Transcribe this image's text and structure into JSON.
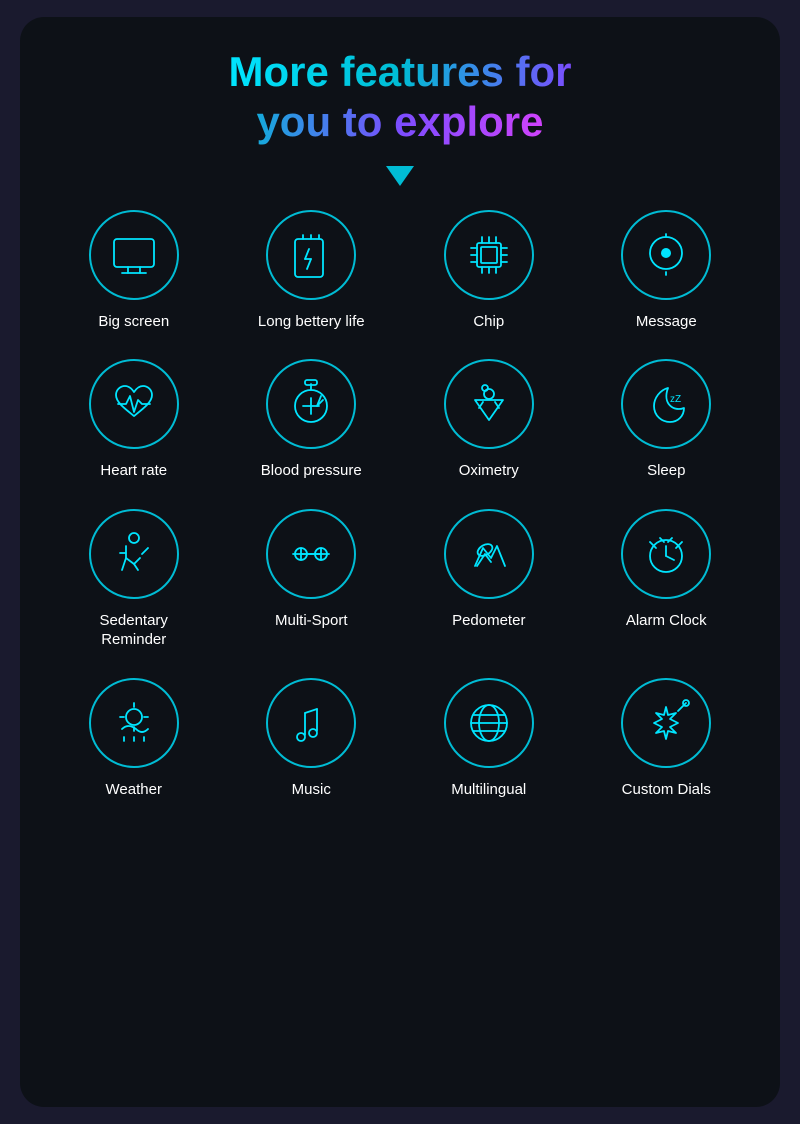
{
  "header": {
    "line1": "More features for",
    "line2": "you to explore"
  },
  "features": [
    {
      "id": "big-screen",
      "label": "Big screen",
      "icon": "big-screen"
    },
    {
      "id": "long-battery",
      "label": "Long bettery life",
      "icon": "battery"
    },
    {
      "id": "chip",
      "label": "Chip",
      "icon": "chip"
    },
    {
      "id": "message",
      "label": "Message",
      "icon": "message"
    },
    {
      "id": "heart-rate",
      "label": "Heart rate",
      "icon": "heart-rate"
    },
    {
      "id": "blood-pressure",
      "label": "Blood pressure",
      "icon": "blood-pressure"
    },
    {
      "id": "oximetry",
      "label": "Oximetry",
      "icon": "oximetry"
    },
    {
      "id": "sleep",
      "label": "Sleep",
      "icon": "sleep"
    },
    {
      "id": "sedentary",
      "label": "Sedentary\nReminder",
      "icon": "sedentary"
    },
    {
      "id": "multi-sport",
      "label": "Multi-Sport",
      "icon": "multi-sport"
    },
    {
      "id": "pedometer",
      "label": "Pedometer",
      "icon": "pedometer"
    },
    {
      "id": "alarm-clock",
      "label": "Alarm Clock",
      "icon": "alarm-clock"
    },
    {
      "id": "weather",
      "label": "Weather",
      "icon": "weather"
    },
    {
      "id": "music",
      "label": "Music",
      "icon": "music"
    },
    {
      "id": "multilingual",
      "label": "Multilingual",
      "icon": "multilingual"
    },
    {
      "id": "custom-dials",
      "label": "Custom Dials",
      "icon": "custom-dials"
    }
  ]
}
